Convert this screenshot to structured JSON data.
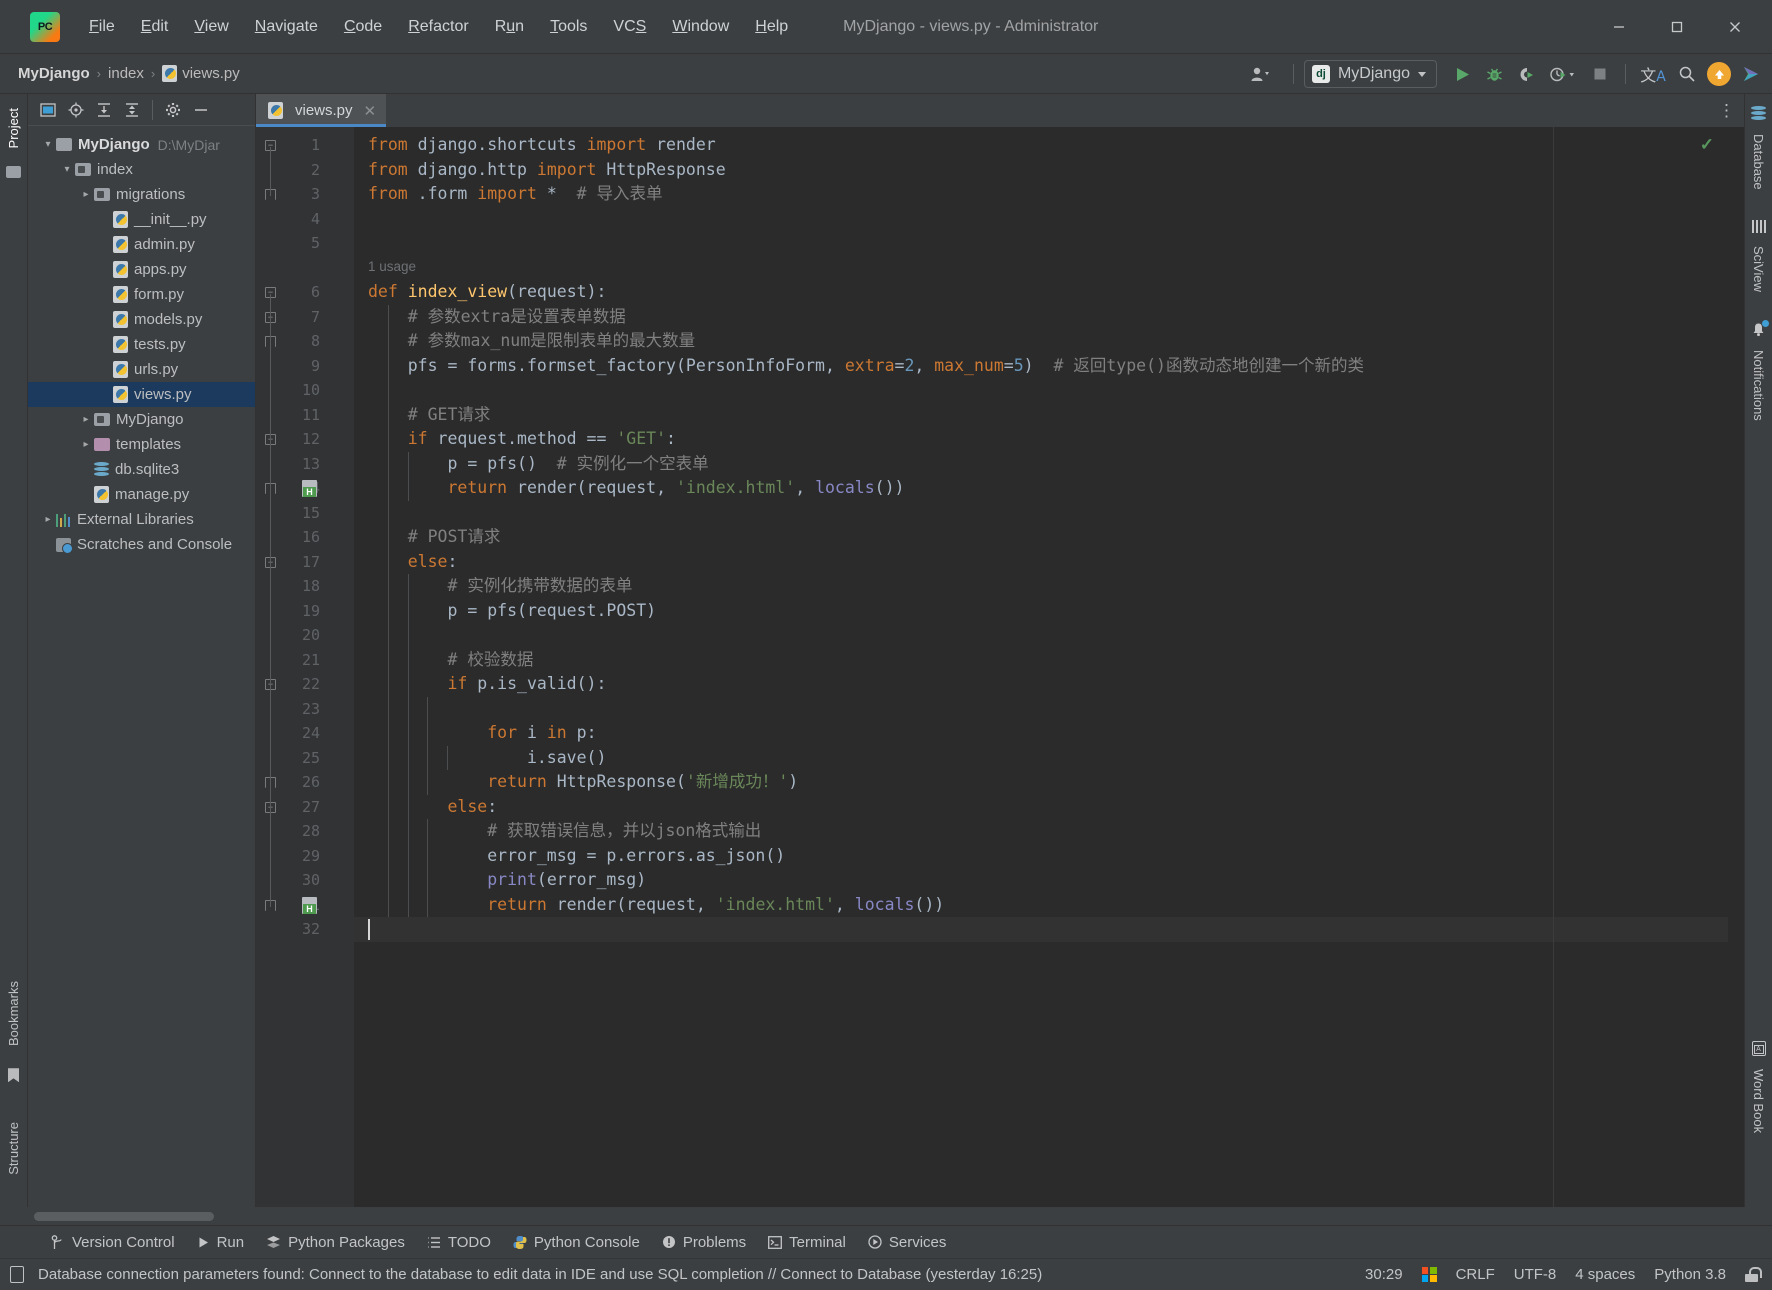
{
  "titlebar": {
    "logo": "pycharm-logo",
    "menus": [
      "File",
      "Edit",
      "View",
      "Navigate",
      "Code",
      "Refactor",
      "Run",
      "Tools",
      "VCS",
      "Window",
      "Help"
    ],
    "window_title": "MyDjango - views.py - Administrator",
    "minimize": "—",
    "maximize": "☐",
    "close": "✕"
  },
  "navbar": {
    "breadcrumbs": [
      "MyDjango",
      "index",
      "views.py"
    ],
    "separator": "›",
    "profile_icon": "user-icon",
    "run_config": {
      "icon_label": "dj",
      "name": "MyDjango"
    },
    "buttons": [
      {
        "name": "run-button",
        "glyph": "▶",
        "color": "#59a869"
      },
      {
        "name": "debug-button",
        "glyph": "bug",
        "color": "#59a869"
      },
      {
        "name": "run-with-coverage-button",
        "glyph": "coverage",
        "color": "#59a869"
      },
      {
        "name": "profile-button",
        "glyph": "clock",
        "color": "#59a869"
      },
      {
        "name": "stop-button",
        "glyph": "■",
        "color": "#7e8183"
      },
      {
        "name": "translate-button",
        "glyph": "文A",
        "color": "#c4c6c8"
      },
      {
        "name": "search-everywhere-button",
        "glyph": "⌕",
        "color": "#c4c6c8"
      },
      {
        "name": "update-button",
        "glyph": "↑",
        "color": "#f0a732"
      },
      {
        "name": "ide-feature-button",
        "glyph": "▶",
        "color": "#4aaf7d"
      }
    ]
  },
  "left_stripe": {
    "top": [
      "Project"
    ],
    "bottom": [
      "Bookmarks",
      "Structure"
    ]
  },
  "right_stripe": {
    "top": [
      "Database",
      "SciView",
      "Notifications"
    ],
    "bottom": [
      "Word Book"
    ]
  },
  "project_panel": {
    "toolbar_icons": [
      "select-opened-file-icon",
      "target-icon",
      "expand-all-icon",
      "collapse-all-icon",
      "settings-gear-icon",
      "hide-icon"
    ],
    "tree": [
      {
        "depth": 0,
        "arrow": "⌄",
        "icon": "folder",
        "label": "MyDjango",
        "bold": true,
        "path": "D:\\MyDjar",
        "selected": false
      },
      {
        "depth": 1,
        "arrow": "⌄",
        "icon": "folder-src",
        "label": "index",
        "bold": false,
        "path": "",
        "selected": false
      },
      {
        "depth": 2,
        "arrow": "›",
        "icon": "folder-src",
        "label": "migrations",
        "bold": false,
        "path": "",
        "selected": false
      },
      {
        "depth": 3,
        "arrow": "",
        "icon": "python-file",
        "label": "__init__.py",
        "bold": false,
        "path": "",
        "selected": false
      },
      {
        "depth": 3,
        "arrow": "",
        "icon": "python-file",
        "label": "admin.py",
        "bold": false,
        "path": "",
        "selected": false
      },
      {
        "depth": 3,
        "arrow": "",
        "icon": "python-file",
        "label": "apps.py",
        "bold": false,
        "path": "",
        "selected": false
      },
      {
        "depth": 3,
        "arrow": "",
        "icon": "python-file",
        "label": "form.py",
        "bold": false,
        "path": "",
        "selected": false
      },
      {
        "depth": 3,
        "arrow": "",
        "icon": "python-file",
        "label": "models.py",
        "bold": false,
        "path": "",
        "selected": false
      },
      {
        "depth": 3,
        "arrow": "",
        "icon": "python-file",
        "label": "tests.py",
        "bold": false,
        "path": "",
        "selected": false
      },
      {
        "depth": 3,
        "arrow": "",
        "icon": "python-file",
        "label": "urls.py",
        "bold": false,
        "path": "",
        "selected": false
      },
      {
        "depth": 3,
        "arrow": "",
        "icon": "python-file",
        "label": "views.py",
        "bold": false,
        "path": "",
        "selected": true
      },
      {
        "depth": 2,
        "arrow": "›",
        "icon": "folder-src",
        "label": "MyDjango",
        "bold": false,
        "path": "",
        "selected": false
      },
      {
        "depth": 2,
        "arrow": "›",
        "icon": "folder-purple",
        "label": "templates",
        "bold": false,
        "path": "",
        "selected": false
      },
      {
        "depth": 2,
        "arrow": "",
        "icon": "database-file",
        "label": "db.sqlite3",
        "bold": false,
        "path": "",
        "selected": false
      },
      {
        "depth": 2,
        "arrow": "",
        "icon": "python-file",
        "label": "manage.py",
        "bold": false,
        "path": "",
        "selected": false
      },
      {
        "depth": 0,
        "arrow": "›",
        "icon": "library",
        "label": "External Libraries",
        "bold": false,
        "path": "",
        "selected": false
      },
      {
        "depth": 0,
        "arrow": "",
        "icon": "scratches",
        "label": "Scratches and Console",
        "bold": false,
        "path": "",
        "selected": false
      }
    ]
  },
  "editor": {
    "tab": {
      "label": "views.py",
      "close": "✕",
      "icon": "python-file-icon"
    },
    "more_actions": "⋮",
    "inspection_status": "✓",
    "usage_hint": "1 usage",
    "lines": [
      {
        "n": 1,
        "tokens": [
          [
            "kw",
            "from"
          ],
          [
            "id",
            " django.shortcuts "
          ],
          [
            "kw",
            "import"
          ],
          [
            "id",
            " render"
          ]
        ]
      },
      {
        "n": 2,
        "tokens": [
          [
            "kw",
            "from"
          ],
          [
            "id",
            " django.http "
          ],
          [
            "kw",
            "import"
          ],
          [
            "id",
            " HttpResponse"
          ]
        ]
      },
      {
        "n": 3,
        "tokens": [
          [
            "kw",
            "from"
          ],
          [
            "id",
            " .form "
          ],
          [
            "kw",
            "import"
          ],
          [
            "id",
            " * "
          ],
          [
            "cm",
            " # 导入表单"
          ]
        ]
      },
      {
        "n": 4,
        "tokens": []
      },
      {
        "n": 5,
        "tokens": []
      },
      {
        "n": 6,
        "tokens": [
          [
            "kw",
            "def "
          ],
          [
            "fn",
            "index_view"
          ],
          [
            "id",
            "(request):"
          ]
        ]
      },
      {
        "n": 7,
        "tokens": [
          [
            "cm",
            "    # 参数extra是设置表单数据"
          ]
        ]
      },
      {
        "n": 8,
        "tokens": [
          [
            "cm",
            "    # 参数max_num是限制表单的最大数量"
          ]
        ]
      },
      {
        "n": 9,
        "tokens": [
          [
            "id",
            "    pfs = forms.formset_factory(PersonInfoForm, "
          ],
          [
            "param",
            "extra"
          ],
          [
            "id",
            "="
          ],
          [
            "num",
            "2"
          ],
          [
            "id",
            ", "
          ],
          [
            "param",
            "max_num"
          ],
          [
            "id",
            "="
          ],
          [
            "num",
            "5"
          ],
          [
            "id",
            ")"
          ],
          [
            "cm",
            "  # 返回type()函数动态地创建一个新的类"
          ]
        ]
      },
      {
        "n": 10,
        "tokens": []
      },
      {
        "n": 11,
        "tokens": [
          [
            "cm",
            "    # GET请求"
          ]
        ]
      },
      {
        "n": 12,
        "tokens": [
          [
            "kw",
            "    if"
          ],
          [
            "id",
            " request.method == "
          ],
          [
            "str",
            "'GET'"
          ],
          [
            "id",
            ":"
          ]
        ]
      },
      {
        "n": 13,
        "tokens": [
          [
            "id",
            "        p = pfs()"
          ],
          [
            "cm",
            "  # 实例化一个空表单"
          ]
        ]
      },
      {
        "n": 14,
        "tokens": [
          [
            "kw",
            "        return"
          ],
          [
            "id",
            " render(request, "
          ],
          [
            "str",
            "'index.html'"
          ],
          [
            "id",
            ", "
          ],
          [
            "bi",
            "locals"
          ],
          [
            "id",
            "())"
          ]
        ]
      },
      {
        "n": 15,
        "tokens": []
      },
      {
        "n": 16,
        "tokens": [
          [
            "cm",
            "    # POST请求"
          ]
        ]
      },
      {
        "n": 17,
        "tokens": [
          [
            "kw",
            "    else"
          ],
          [
            "id",
            ":"
          ]
        ]
      },
      {
        "n": 18,
        "tokens": [
          [
            "cm",
            "        # 实例化携带数据的表单"
          ]
        ]
      },
      {
        "n": 19,
        "tokens": [
          [
            "id",
            "        p = pfs(request.POST)"
          ]
        ]
      },
      {
        "n": 20,
        "tokens": []
      },
      {
        "n": 21,
        "tokens": [
          [
            "cm",
            "        # 校验数据"
          ]
        ]
      },
      {
        "n": 22,
        "tokens": [
          [
            "kw",
            "        if"
          ],
          [
            "id",
            " p.is_valid():"
          ]
        ]
      },
      {
        "n": 23,
        "tokens": []
      },
      {
        "n": 24,
        "tokens": [
          [
            "kw",
            "            for"
          ],
          [
            "id",
            " i "
          ],
          [
            "kw",
            "in"
          ],
          [
            "id",
            " p:"
          ]
        ]
      },
      {
        "n": 25,
        "tokens": [
          [
            "id",
            "                i.save()"
          ]
        ]
      },
      {
        "n": 26,
        "tokens": [
          [
            "kw",
            "            return"
          ],
          [
            "id",
            " HttpResponse("
          ],
          [
            "str",
            "'新增成功！'"
          ],
          [
            "id",
            ")"
          ]
        ]
      },
      {
        "n": 27,
        "tokens": [
          [
            "kw",
            "        else"
          ],
          [
            "id",
            ":"
          ]
        ]
      },
      {
        "n": 28,
        "tokens": [
          [
            "cm",
            "            # 获取错误信息，并以json格式输出"
          ]
        ]
      },
      {
        "n": 29,
        "tokens": [
          [
            "id",
            "            error_msg = p.errors.as_json()"
          ]
        ]
      },
      {
        "n": 30,
        "tokens": [
          [
            "bi",
            "            print"
          ],
          [
            "id",
            "(error_msg)"
          ]
        ]
      },
      {
        "n": 31,
        "tokens": [
          [
            "kw",
            "            return"
          ],
          [
            "id",
            " render(request, "
          ],
          [
            "str",
            "'index.html'"
          ],
          [
            "id",
            ", "
          ],
          [
            "bi",
            "locals"
          ],
          [
            "id",
            "())"
          ]
        ]
      },
      {
        "n": 32,
        "tokens": []
      }
    ],
    "current_line": 32,
    "fold_lines": [
      1,
      3,
      6,
      7,
      8,
      12,
      14,
      17,
      22,
      26,
      27,
      31
    ],
    "html_markers": [
      14,
      31
    ]
  },
  "toolwindow_bar": [
    {
      "label": "Version Control",
      "icon": "branch-icon"
    },
    {
      "label": "Run",
      "icon": "play-icon"
    },
    {
      "label": "Python Packages",
      "icon": "packages-icon"
    },
    {
      "label": "TODO",
      "icon": "list-icon"
    },
    {
      "label": "Python Console",
      "icon": "python-icon"
    },
    {
      "label": "Problems",
      "icon": "warning-icon"
    },
    {
      "label": "Terminal",
      "icon": "terminal-icon"
    },
    {
      "label": "Services",
      "icon": "services-icon"
    }
  ],
  "statusbar": {
    "message": "Database connection parameters found: Connect to the database to edit data in IDE and use SQL completion // Connect to Database (yesterday 16:25)",
    "message_icon": "database-hint-icon",
    "caret_position": "30:29",
    "os_indicator": "windows-logo",
    "line_separator": "CRLF",
    "encoding": "UTF-8",
    "indent": "4 spaces",
    "interpreter": "Python 3.8",
    "lock": "unlocked-icon"
  }
}
